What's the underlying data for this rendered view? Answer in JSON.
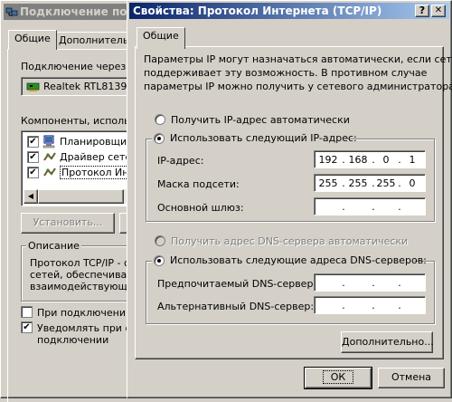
{
  "back_window": {
    "title": "Подключение по",
    "tabs": [
      "Общие",
      "Дополнительно"
    ],
    "connect_via_label": "Подключение через:",
    "adapter_name": "Realtek RTL8139",
    "components_label": "Компоненты, использу",
    "components": [
      {
        "label": "Планировщик",
        "checked": true,
        "icon": "network-icon"
      },
      {
        "label": "Драйвер сетев",
        "checked": true,
        "icon": "network-driver-icon"
      },
      {
        "label": "Протокол Инте",
        "checked": true,
        "icon": "protocol-icon"
      }
    ],
    "install_button": "Установить...",
    "description_caption": "Описание",
    "description_text": [
      "Протокол TCP/IP - с",
      "сетей, обеспечиваю",
      "взаимодействующи"
    ],
    "show_icon_option": "При подключении в",
    "notify_option": [
      "Уведомлять при ог",
      "подключении"
    ],
    "notify_checked": true
  },
  "dialog": {
    "title": "Свойства: Протокол Интернета (TCP/IP)",
    "help_button": "?",
    "close_button": "✕",
    "tab": "Общие",
    "info_text": [
      "Параметры IP могут назначаться автоматически, если сеть",
      "поддерживает эту возможность. В противном случае",
      "параметры  IP можно получить у сетевого администратора."
    ],
    "ip_auto_option": "Получить IP-адрес автоматически",
    "ip_manual_option": "Использовать следующий IP-адрес:",
    "ip_mode": "manual",
    "ip_address_label": "IP-адрес:",
    "ip_address": [
      "192",
      "168",
      "0",
      "1"
    ],
    "subnet_label": "Маска подсети:",
    "subnet_mask": [
      "255",
      "255",
      "255",
      "0"
    ],
    "gateway_label": "Основной шлюз:",
    "gateway": [
      "",
      "",
      "",
      ""
    ],
    "dns_auto_option": "Получить адрес DNS-сервера автоматически",
    "dns_manual_option": "Использовать следующие адреса DNS-серверов:",
    "dns_mode": "manual",
    "preferred_dns_label": "Предпочитаемый DNS-сервер:",
    "preferred_dns": [
      "",
      "",
      "",
      ""
    ],
    "alternate_dns_label": "Альтернативный DNS-сервер:",
    "alternate_dns": [
      "",
      "",
      "",
      ""
    ],
    "advanced_button": "Дополнительно...",
    "ok_button": "ОК",
    "cancel_button": "Отмена"
  },
  "colors": {
    "title_active_start": "#0a246a",
    "title_active_end": "#a6caf0",
    "title_inactive": "#808080",
    "face": "#d4d0c8"
  }
}
